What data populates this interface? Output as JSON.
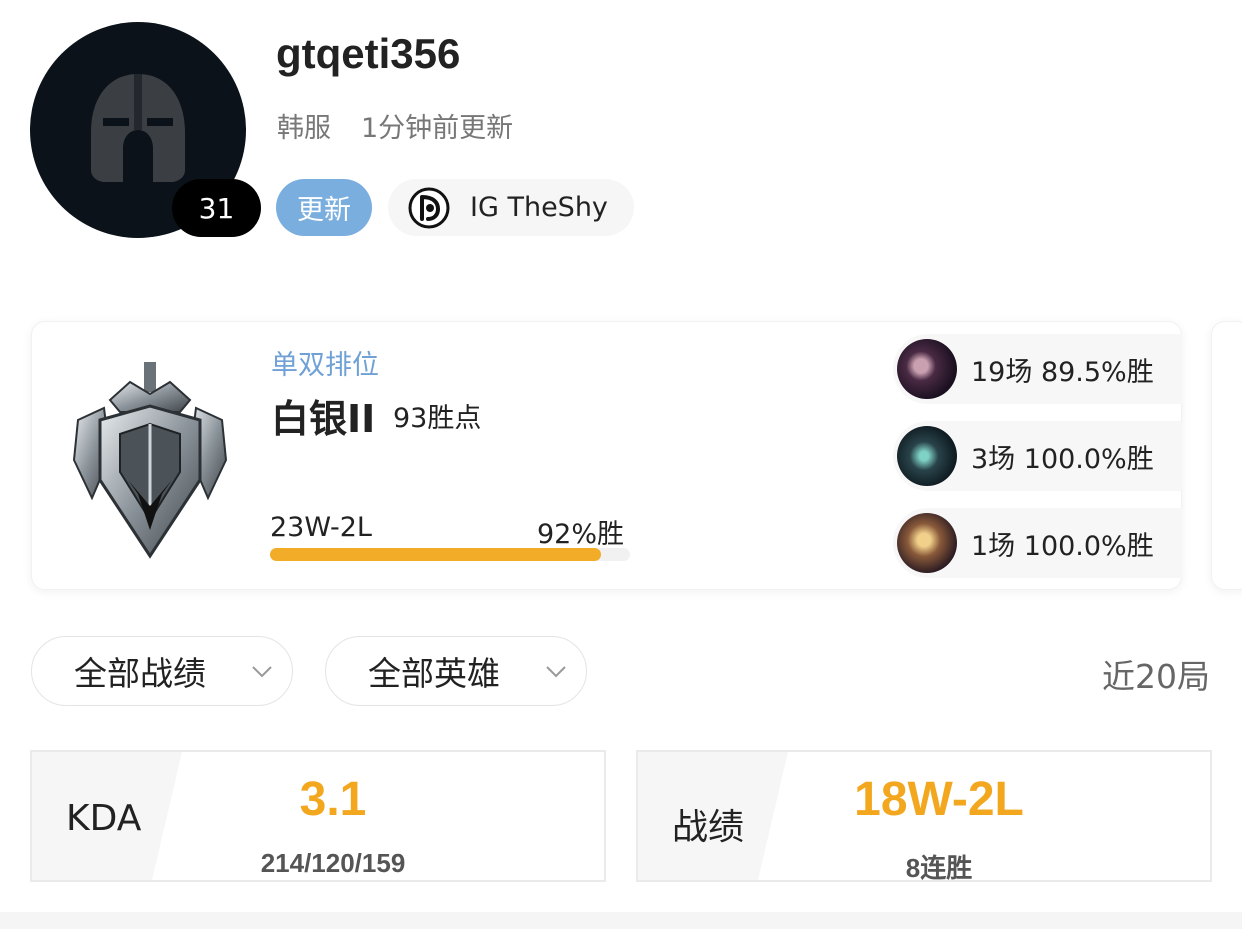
{
  "profile": {
    "username": "gtqeti356",
    "server": "韩服",
    "updated": "1分钟前更新",
    "level": "31",
    "update_button": "更新",
    "pro_tag": "IG TheShy",
    "avatar_icon": "spartan-helmet-icon",
    "team_logo_icon": "ig-logo-icon"
  },
  "rank": {
    "queue": "单双排位",
    "tier": "白银II",
    "lp": "93胜点",
    "record": "23W-2L",
    "winrate": "92%胜",
    "winrate_fraction": 0.92,
    "emblem_icon": "silver-rank-emblem-icon"
  },
  "champions": [
    {
      "icon": "champion-portrait-1",
      "text": "19场 89.5%胜"
    },
    {
      "icon": "champion-portrait-2",
      "text": "3场 100.0%胜"
    },
    {
      "icon": "champion-portrait-3",
      "text": "1场 100.0%胜"
    }
  ],
  "filters": {
    "matches": "全部战绩",
    "heroes": "全部英雄",
    "recent": "近20局"
  },
  "stats": {
    "kda_label": "KDA",
    "kda_value": "3.1",
    "kda_detail": "214/120/159",
    "record_label": "战绩",
    "record_value": "18W-2L",
    "record_detail": "8连胜"
  },
  "colors": {
    "accent_orange": "#f2a71f",
    "update_blue": "#7aaedf",
    "queue_blue": "#6fa1d6"
  }
}
